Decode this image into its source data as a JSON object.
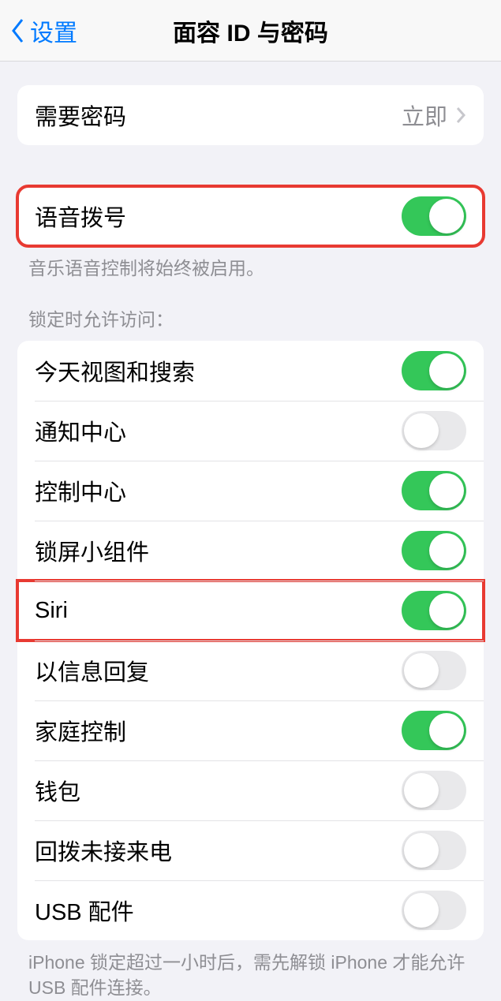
{
  "nav": {
    "back": "设置",
    "title": "面容 ID 与密码"
  },
  "require_passcode": {
    "label": "需要密码",
    "value": "立即"
  },
  "voice_dial": {
    "label": "语音拨号",
    "on": true,
    "footer": "音乐语音控制将始终被启用。"
  },
  "lock_access_header": "锁定时允许访问：",
  "lock_access_items": [
    {
      "label": "今天视图和搜索",
      "on": true
    },
    {
      "label": "通知中心",
      "on": false
    },
    {
      "label": "控制中心",
      "on": true
    },
    {
      "label": "锁屏小组件",
      "on": true
    },
    {
      "label": "Siri",
      "on": true
    },
    {
      "label": "以信息回复",
      "on": false
    },
    {
      "label": "家庭控制",
      "on": true
    },
    {
      "label": "钱包",
      "on": false
    },
    {
      "label": "回拨未接来电",
      "on": false
    },
    {
      "label": "USB 配件",
      "on": false
    }
  ],
  "usb_footer": "iPhone 锁定超过一小时后，需先解锁 iPhone 才能允许 USB 配件连接。",
  "highlights": {
    "voice_dial_group": true,
    "lock_item_index": 4
  }
}
